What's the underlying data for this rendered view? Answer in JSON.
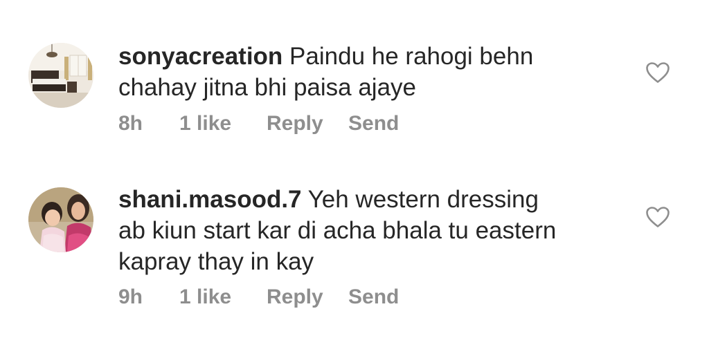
{
  "comments": [
    {
      "avatar_icon": "bedroom-photo-avatar",
      "username": "sonyacreation",
      "text_line1": "Paindu he rahogi behn",
      "text_line2": "chahay jitna bhi paisa ajaye",
      "time": "8h",
      "likes": "1 like",
      "reply_label": "Reply",
      "send_label": "Send",
      "like_icon": "heart-outline-icon"
    },
    {
      "avatar_icon": "mother-child-photo-avatar",
      "username": "shani.masood.7",
      "text_line1": "Yeh western dressing",
      "text_line2": "ab kiun start kar di acha bhala tu eastern",
      "text_line3": "kapray thay in kay",
      "time": "9h",
      "likes": "1 like",
      "reply_label": "Reply",
      "send_label": "Send",
      "like_icon": "heart-outline-icon"
    }
  ],
  "colors": {
    "text": "#262626",
    "meta": "#8e8e8e",
    "icon": "#8e8e8e",
    "background": "#ffffff"
  }
}
